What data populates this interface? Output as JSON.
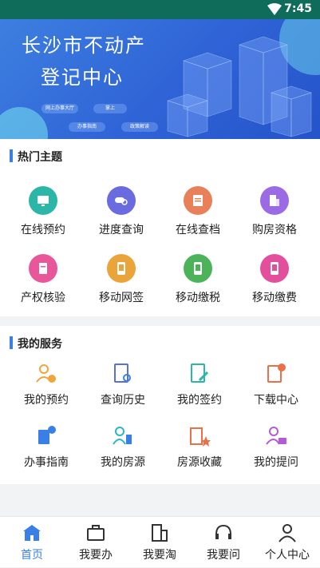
{
  "status": {
    "time": "7:45"
  },
  "banner": {
    "title_line1": "长沙市不动产",
    "title_line2": "登记中心",
    "pills": [
      "网上办事大厅",
      "掌上",
      "办事指南",
      "政策解读"
    ]
  },
  "hot": {
    "heading": "热门主题",
    "items": [
      {
        "label": "在线预约",
        "icon": "monitor-icon",
        "color": "#2bb6a8"
      },
      {
        "label": "进度查询",
        "icon": "search-progress-icon",
        "color": "#6b6be0"
      },
      {
        "label": "在线查档",
        "icon": "archive-icon",
        "color": "#e8805a"
      },
      {
        "label": "购房资格",
        "icon": "building-icon",
        "color": "#9b6be6"
      },
      {
        "label": "产权核验",
        "icon": "document-icon",
        "color": "#e8579a"
      },
      {
        "label": "移动网签",
        "icon": "sign-icon",
        "color": "#e9a43a"
      },
      {
        "label": "移动缴税",
        "icon": "tax-icon",
        "color": "#4cb35a"
      },
      {
        "label": "移动缴费",
        "icon": "pay-icon",
        "color": "#e34f9d"
      }
    ]
  },
  "services": {
    "heading": "我的服务",
    "items": [
      {
        "label": "我的预约",
        "icon": "user-clock-icon",
        "color": "#f0a53a"
      },
      {
        "label": "查询历史",
        "icon": "file-search-icon",
        "color": "#5a6fd8"
      },
      {
        "label": "我的签约",
        "icon": "file-edit-icon",
        "color": "#2bb6a8"
      },
      {
        "label": "下载中心",
        "icon": "download-icon",
        "color": "#e8704a"
      },
      {
        "label": "办事指南",
        "icon": "guide-icon",
        "color": "#3a7fe6"
      },
      {
        "label": "我的房源",
        "icon": "user-building-icon",
        "color": "#2bb6c8"
      },
      {
        "label": "房源收藏",
        "icon": "building-star-icon",
        "color": "#e8704a"
      },
      {
        "label": "我的提问",
        "icon": "user-question-icon",
        "color": "#b45ad8"
      }
    ]
  },
  "tabs": [
    {
      "label": "首页",
      "icon": "home-icon",
      "active": true
    },
    {
      "label": "我要办",
      "icon": "briefcase-icon",
      "active": false
    },
    {
      "label": "我要淘",
      "icon": "buildings-icon",
      "active": false
    },
    {
      "label": "我要问",
      "icon": "headset-icon",
      "active": false
    },
    {
      "label": "个人中心",
      "icon": "person-icon",
      "active": false
    }
  ],
  "colors": {
    "accent": "#3a7fe6",
    "statusbar": "#0f6b5a"
  }
}
